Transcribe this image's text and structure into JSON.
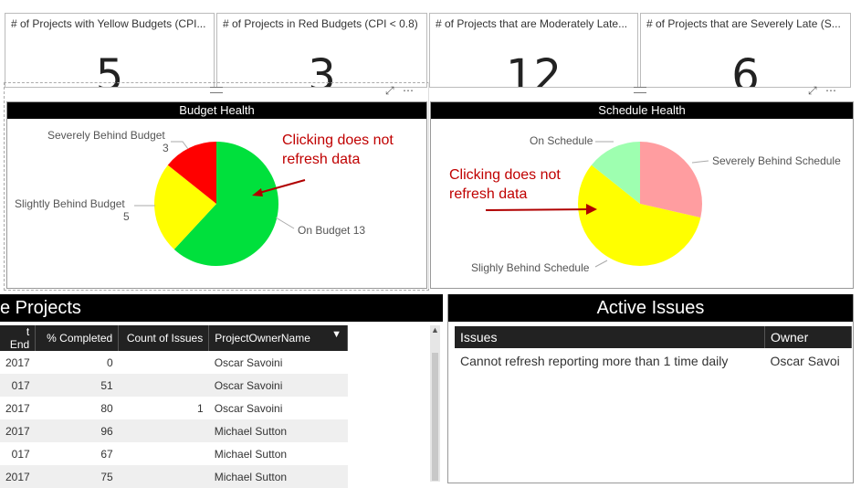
{
  "kpis": [
    {
      "title": "# of Projects with Yellow Budgets (CPI...",
      "value": "5"
    },
    {
      "title": "# of Projects in Red Budgets (CPI < 0.8)",
      "value": "3"
    },
    {
      "title": "# of Projects that are Moderately Late...",
      "value": "12"
    },
    {
      "title": "# of Projects that are Severely Late (S...",
      "value": "6"
    }
  ],
  "budget": {
    "title": "Budget Health",
    "slices": [
      {
        "label": "On Budget 13",
        "value": 13,
        "color": "#00e03c"
      },
      {
        "label": "Slightly Behind Budget",
        "count": "5",
        "value": 5,
        "color": "#ffff00"
      },
      {
        "label": "Severely Behind Budget",
        "count": "3",
        "value": 3,
        "color": "#ff0000"
      }
    ],
    "annotation": [
      "Clicking does not",
      "refresh data"
    ]
  },
  "schedule": {
    "title": "Schedule Health",
    "slices": [
      {
        "label": "Severely Behind Schedule",
        "value": 6,
        "color": "#ff9da0"
      },
      {
        "label": "Slighly Behind Schedule",
        "value": 12,
        "color": "#ffff00"
      },
      {
        "label": "On Schedule",
        "value": 3,
        "color": "#9effb0"
      }
    ],
    "annotation": [
      "Clicking does not",
      "refresh data"
    ]
  },
  "projects": {
    "title": "e Projects",
    "columns": [
      "t End",
      "% Completed",
      "Count of Issues",
      "ProjectOwnerName"
    ],
    "rows": [
      [
        "2017",
        "0",
        "",
        "Oscar Savoini"
      ],
      [
        "017",
        "51",
        "",
        "Oscar Savoini"
      ],
      [
        "2017",
        "80",
        "1",
        "Oscar Savoini"
      ],
      [
        "2017",
        "96",
        "",
        "Michael Sutton"
      ],
      [
        "017",
        "67",
        "",
        "Michael Sutton"
      ],
      [
        "2017",
        "75",
        "",
        "Michael Sutton"
      ]
    ]
  },
  "issues": {
    "title": "Active Issues",
    "columns": [
      "Issues",
      "Owner"
    ],
    "rows": [
      [
        "Cannot refresh reporting more than 1 time daily",
        "Oscar Savoi"
      ]
    ]
  },
  "icons": {
    "focus": "focus-mode-icon",
    "more": "more-options-icon",
    "sort": "sort-desc-icon"
  }
}
